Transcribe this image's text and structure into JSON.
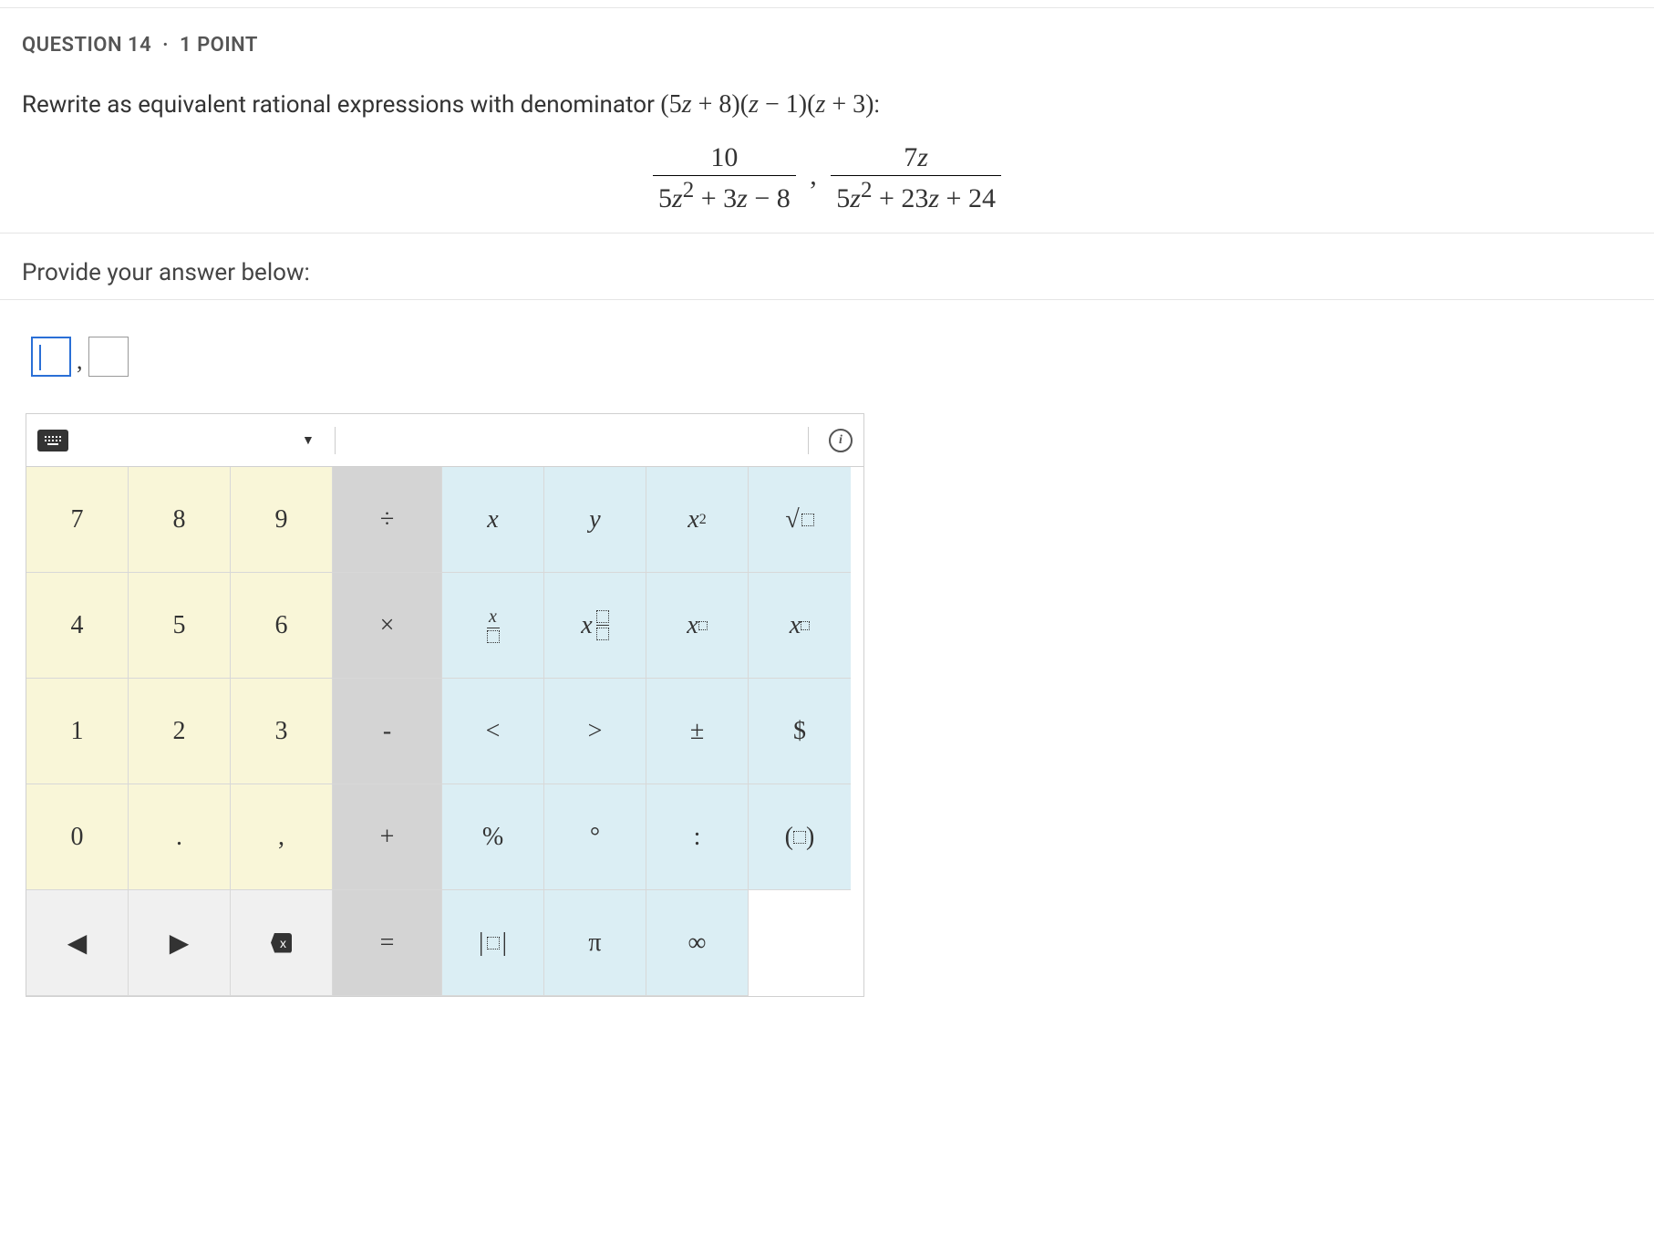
{
  "question": {
    "label_prefix": "QUESTION",
    "number": "14",
    "points": "1 POINT",
    "prompt_prefix": "Rewrite as equivalent rational expressions with denominator ",
    "target_denominator": "(5z + 8)(z − 1)(z + 3)",
    "prompt_suffix": ":",
    "expr1_num": "10",
    "expr1_den": "5z² + 3z − 8",
    "expr_sep": ",",
    "expr2_num": "7z",
    "expr2_den": "5z² + 23z + 24"
  },
  "answer_label": "Provide your answer below:",
  "answer_inputs": {
    "box1": "",
    "separator": ",",
    "box2": ""
  },
  "keypad": {
    "rows": [
      [
        "7",
        "8",
        "9",
        "÷",
        "x",
        "y",
        "x²",
        "√"
      ],
      [
        "4",
        "5",
        "6",
        "×",
        "frac",
        "mixed",
        "power",
        "subscript"
      ],
      [
        "1",
        "2",
        "3",
        "-",
        "<",
        ">",
        "±",
        "$"
      ],
      [
        "0",
        ".",
        ",",
        "+",
        "%",
        "°",
        ":",
        "paren"
      ],
      [
        "◀",
        "▶",
        "⌫",
        "=",
        "abs",
        "π",
        "∞",
        ""
      ]
    ],
    "labels": {
      "divide": "÷",
      "multiply": "×",
      "minus": "-",
      "plus": "+",
      "equals": "=",
      "x": "x",
      "y": "y",
      "lt": "<",
      "gt": ">",
      "pm": "±",
      "dollar": "$",
      "percent": "%",
      "degree": "°",
      "colon": ":",
      "pi": "π",
      "infinity": "∞",
      "dot": ".",
      "comma": ",",
      "n0": "0",
      "n1": "1",
      "n2": "2",
      "n3": "3",
      "n4": "4",
      "n5": "5",
      "n6": "6",
      "n7": "7",
      "n8": "8",
      "n9": "9"
    }
  }
}
